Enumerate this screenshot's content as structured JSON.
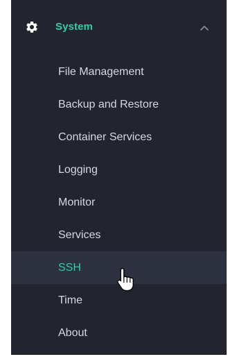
{
  "sidebar": {
    "group": {
      "label": "System",
      "icon": "gear-icon",
      "expanded": true,
      "toggle_icon": "chevron-up-icon"
    },
    "items": [
      {
        "label": "File Management",
        "active": false
      },
      {
        "label": "Backup and Restore",
        "active": false
      },
      {
        "label": "Container Services",
        "active": false
      },
      {
        "label": "Logging",
        "active": false
      },
      {
        "label": "Monitor",
        "active": false
      },
      {
        "label": "Services",
        "active": false
      },
      {
        "label": "SSH",
        "active": true
      },
      {
        "label": "Time",
        "active": false
      },
      {
        "label": "About",
        "active": false
      }
    ]
  },
  "colors": {
    "background": "#222530",
    "accent": "#2ecfa0",
    "hover_row": "#2e3140",
    "text": "#d6d8de"
  },
  "cursor": {
    "icon": "hand-pointer-icon"
  }
}
